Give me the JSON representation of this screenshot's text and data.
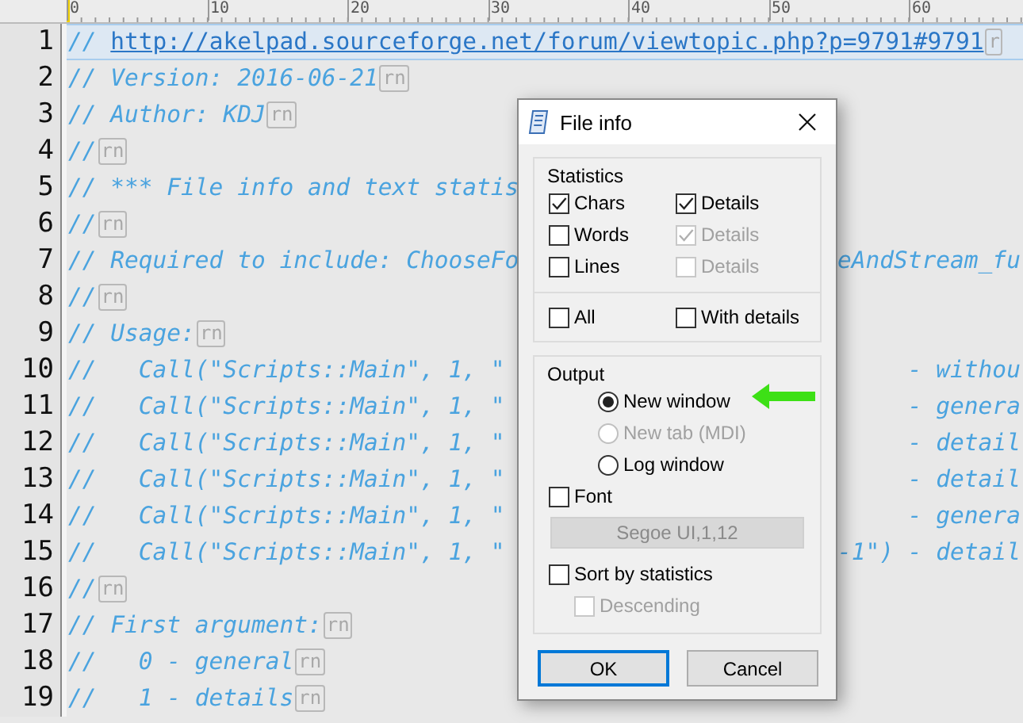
{
  "ruler": {
    "labels": [
      "0",
      "10",
      "20",
      "30",
      "40",
      "50",
      "60"
    ]
  },
  "editor": {
    "lines": [
      {
        "number": "1",
        "current": true,
        "left": "// ",
        "link": "http://akelpad.sourceforge.net/forum/viewtopic.php?p=9791#9791",
        "end_mark": "r"
      },
      {
        "number": "2",
        "current": false,
        "left": "// Version: 2016-06-21",
        "end_mark": "rn"
      },
      {
        "number": "3",
        "current": false,
        "left": "// Author: KDJ",
        "end_mark": "rn"
      },
      {
        "number": "4",
        "current": false,
        "left": "//",
        "end_mark": "rn"
      },
      {
        "number": "5",
        "current": false,
        "left": "// *** File info and text statis"
      },
      {
        "number": "6",
        "current": false,
        "left": "//",
        "end_mark": "rn"
      },
      {
        "number": "7",
        "current": false,
        "left": "// Required to include: ChooseFo",
        "right": "eAndStream_fu"
      },
      {
        "number": "8",
        "current": false,
        "left": "//",
        "end_mark": "rn"
      },
      {
        "number": "9",
        "current": false,
        "left": "// Usage:",
        "end_mark": "rn"
      },
      {
        "number": "10",
        "current": false,
        "left": "//   Call(\"Scripts::Main\", 1, \"",
        "right": "     - withou"
      },
      {
        "number": "11",
        "current": false,
        "left": "//   Call(\"Scripts::Main\", 1, \"",
        "right": "     - genera"
      },
      {
        "number": "12",
        "current": false,
        "left": "//   Call(\"Scripts::Main\", 1, \"",
        "right": "     - detail"
      },
      {
        "number": "13",
        "current": false,
        "left": "//   Call(\"Scripts::Main\", 1, \"",
        "right": "     - detail"
      },
      {
        "number": "14",
        "current": false,
        "left": "//   Call(\"Scripts::Main\", 1, \"",
        "right": "     - genera"
      },
      {
        "number": "15",
        "current": false,
        "left": "//   Call(\"Scripts::Main\", 1, \"",
        "right": "-1\") - detail"
      },
      {
        "number": "16",
        "current": false,
        "left": "//",
        "end_mark": "rn"
      },
      {
        "number": "17",
        "current": false,
        "left": "// First argument:",
        "end_mark": "rn"
      },
      {
        "number": "18",
        "current": false,
        "left": "//   0 - general",
        "end_mark": "rn"
      },
      {
        "number": "19",
        "current": false,
        "left": "//   1 - details",
        "end_mark": "rn"
      }
    ]
  },
  "dialog": {
    "title": "File info",
    "statistics": {
      "label": "Statistics",
      "rows": [
        [
          {
            "label": "Chars",
            "checked": true,
            "disabled": false
          },
          {
            "label": "Details",
            "checked": true,
            "disabled": false
          }
        ],
        [
          {
            "label": "Words",
            "checked": false,
            "disabled": false
          },
          {
            "label": "Details",
            "checked": true,
            "disabled": true
          }
        ],
        [
          {
            "label": "Lines",
            "checked": false,
            "disabled": false
          },
          {
            "label": "Details",
            "checked": false,
            "disabled": true
          }
        ]
      ],
      "bottom_row": [
        {
          "label": "All",
          "checked": false,
          "disabled": false
        },
        {
          "label": "With details",
          "checked": false,
          "disabled": false
        }
      ]
    },
    "output": {
      "label": "Output",
      "radios": [
        {
          "label": "New window",
          "selected": true,
          "disabled": false
        },
        {
          "label": "New tab (MDI)",
          "selected": false,
          "disabled": true
        },
        {
          "label": "Log window",
          "selected": false,
          "disabled": false
        }
      ],
      "font_checkbox": {
        "label": "Font",
        "checked": false,
        "disabled": false
      },
      "font_button": {
        "label": "Segoe UI,1,12",
        "disabled": true
      },
      "sort_checkbox": {
        "label": "Sort by statistics",
        "checked": false,
        "disabled": false
      },
      "descending_checkbox": {
        "label": "Descending",
        "checked": false,
        "disabled": true
      }
    },
    "buttons": [
      {
        "label": "OK",
        "default": true
      },
      {
        "label": "Cancel",
        "default": false
      }
    ]
  }
}
